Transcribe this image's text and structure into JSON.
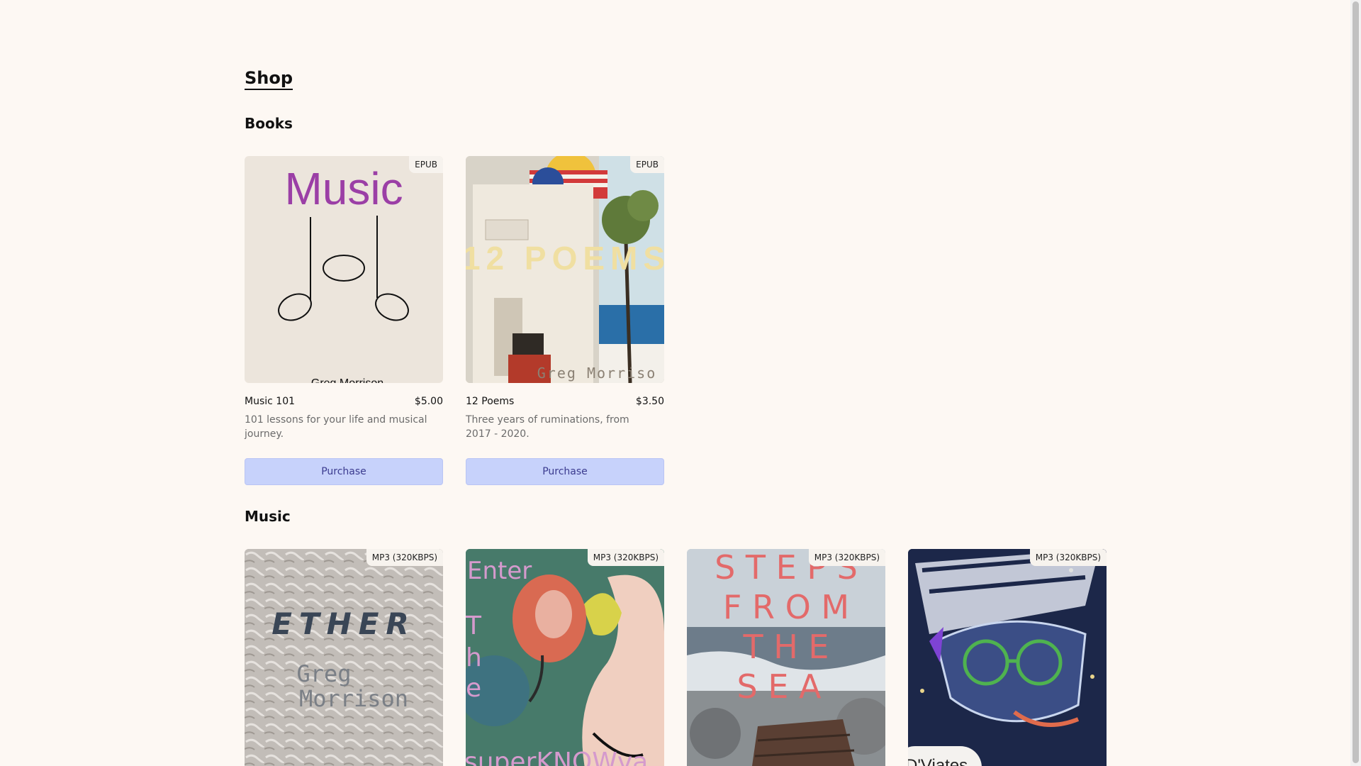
{
  "shop": {
    "title": "Shop"
  },
  "books": {
    "title": "Books",
    "items": [
      {
        "name": "Music 101",
        "price": "$5.00",
        "badge": "EPUB",
        "description": "101 lessons for your life and musical journey.",
        "button": "Purchase",
        "cover_title": "Music",
        "cover_author": "Greg Morrison"
      },
      {
        "name": "12 Poems",
        "price": "$3.50",
        "badge": "EPUB",
        "description": "Three years of ruminations, from 2017 - 2020.",
        "button": "Purchase",
        "cover_title": "12 POEMS",
        "cover_author": "Greg Morriso"
      }
    ]
  },
  "music": {
    "title": "Music",
    "items": [
      {
        "badge": "MP3 (320KBPS)",
        "cover_title": "ETHER",
        "cover_author_line1": "Greg",
        "cover_author_line2": "Morrison"
      },
      {
        "badge": "MP3 (320KBPS)",
        "cover_text_top": "Enter",
        "cover_text_t": "T",
        "cover_text_h": "h",
        "cover_text_e": "e",
        "cover_text_bottom": "superKNOWva"
      },
      {
        "badge": "MP3 (320KBPS)",
        "cover_line1": "S T E P S",
        "cover_line2": "F R O M",
        "cover_line3": "T H E",
        "cover_line4": "S E A"
      },
      {
        "badge": "MP3 (320KBPS)",
        "cover_text": "D'Viates"
      }
    ]
  },
  "colors": {
    "background": "#fdf8f3",
    "button_bg": "#c7d2fb",
    "button_text": "#3b3b8f"
  }
}
